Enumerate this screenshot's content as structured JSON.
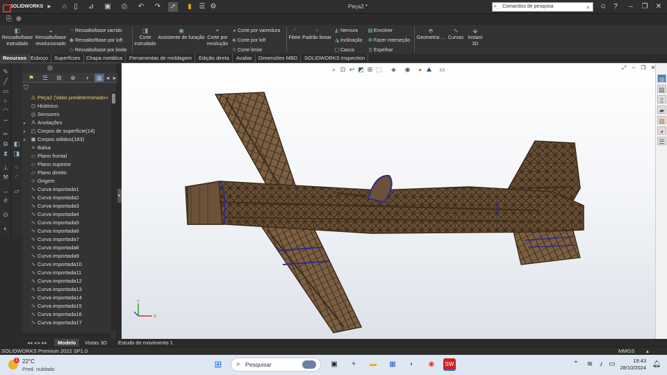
{
  "app": {
    "name": "SOLIDWORKS",
    "document_title": "Peça2 *"
  },
  "search": {
    "placeholder": "Comandos de pesquisa"
  },
  "command_manager": {
    "big": [
      {
        "label": "Ressalto/base\nestrudado",
        "icon": "extruded-boss-icon"
      },
      {
        "label": "Ressalto/base\nrevolucionado",
        "icon": "revolved-boss-icon"
      },
      {
        "label": "Corte\nestrudado",
        "icon": "extruded-cut-icon"
      },
      {
        "label": "Assistente de furação",
        "icon": "hole-wizard-icon"
      },
      {
        "label": "Corte por\nrevolução",
        "icon": "revolved-cut-icon"
      },
      {
        "label": "Filete",
        "icon": "fillet-icon"
      },
      {
        "label": "Padrão linear",
        "icon": "linear-pattern-icon"
      },
      {
        "label": "Geometria ...",
        "icon": "reference-geometry-icon"
      },
      {
        "label": "Curvas",
        "icon": "curves-icon"
      },
      {
        "label": "Instant\n3D",
        "icon": "instant3d-icon"
      }
    ],
    "small_col1": [
      "Ressalto/base varrido",
      "Ressalto/Base por loft",
      "Ressalto/base por limite"
    ],
    "small_col2": [
      "Corte por varredura",
      "Corte por loft",
      "Corte limite"
    ],
    "small_col3": [
      "Nervura",
      "Inclinação",
      "Casca"
    ],
    "small_col4": [
      "Envolver",
      "Fazer interseção",
      "Espelhar"
    ]
  },
  "tabs": [
    "Recursos",
    "Esboço",
    "Superfícies",
    "Chapa metálica",
    "Ferramentas de moldagem",
    "Edição direta",
    "Avaliar",
    "Dimensões MBD",
    "SOLIDWORKS Inspection"
  ],
  "tree": [
    {
      "label": "Peça2 (Valor predeterminado<",
      "icon": "warning-icon",
      "root": true
    },
    {
      "label": "Histórico",
      "icon": "history-icon"
    },
    {
      "label": "Sensores",
      "icon": "sensor-icon"
    },
    {
      "label": "Anotações",
      "icon": "annotations-icon",
      "expand": true
    },
    {
      "label": "Corpos de superfície(14)",
      "icon": "surface-bodies-icon",
      "expand": true
    },
    {
      "label": "Corpos sólidos(183)",
      "icon": "solid-bodies-icon",
      "expand": true
    },
    {
      "label": "Balsa",
      "icon": "material-icon"
    },
    {
      "label": "Plano frontal",
      "icon": "plane-icon"
    },
    {
      "label": "Plano superior",
      "icon": "plane-icon"
    },
    {
      "label": "Plano direito",
      "icon": "plane-icon"
    },
    {
      "label": "Origem",
      "icon": "origin-icon"
    },
    {
      "label": "Curva importada1",
      "icon": "curve-icon"
    },
    {
      "label": "Curva importada2",
      "icon": "curve-icon"
    },
    {
      "label": "Curva importada3",
      "icon": "curve-icon"
    },
    {
      "label": "Curva importada4",
      "icon": "curve-icon"
    },
    {
      "label": "Curva importada5",
      "icon": "curve-icon"
    },
    {
      "label": "Curva importada6",
      "icon": "curve-icon"
    },
    {
      "label": "Curva importada7",
      "icon": "curve-icon"
    },
    {
      "label": "Curva importada8",
      "icon": "curve-icon"
    },
    {
      "label": "Curva importada9",
      "icon": "curve-icon"
    },
    {
      "label": "Curva importada10",
      "icon": "curve-icon"
    },
    {
      "label": "Curva importada11",
      "icon": "curve-icon"
    },
    {
      "label": "Curva importada12",
      "icon": "curve-icon"
    },
    {
      "label": "Curva importada13",
      "icon": "curve-icon"
    },
    {
      "label": "Curva importada14",
      "icon": "curve-icon"
    },
    {
      "label": "Curva importada15",
      "icon": "curve-icon"
    },
    {
      "label": "Curva importada16",
      "icon": "curve-icon"
    },
    {
      "label": "Curva importada17",
      "icon": "curve-icon"
    }
  ],
  "bottom_tabs": [
    "Modelo",
    "Vistas 3D",
    "Estudo de movimento 1"
  ],
  "status": {
    "left": "SOLIDWORKS Premium 2022 SP1.0",
    "units": "MMGS"
  },
  "taskbar": {
    "search": "Pesquisar",
    "weather_temp": "22°C",
    "weather_desc": "Pred. nublado",
    "weather_badge": "1",
    "time": "19:43",
    "date": "28/10/2024"
  },
  "colors": {
    "model": "#6b5238",
    "model_dark": "#3d2c1a",
    "curves": "#2e2a8a",
    "ui_dark": "#2b2b2b"
  }
}
